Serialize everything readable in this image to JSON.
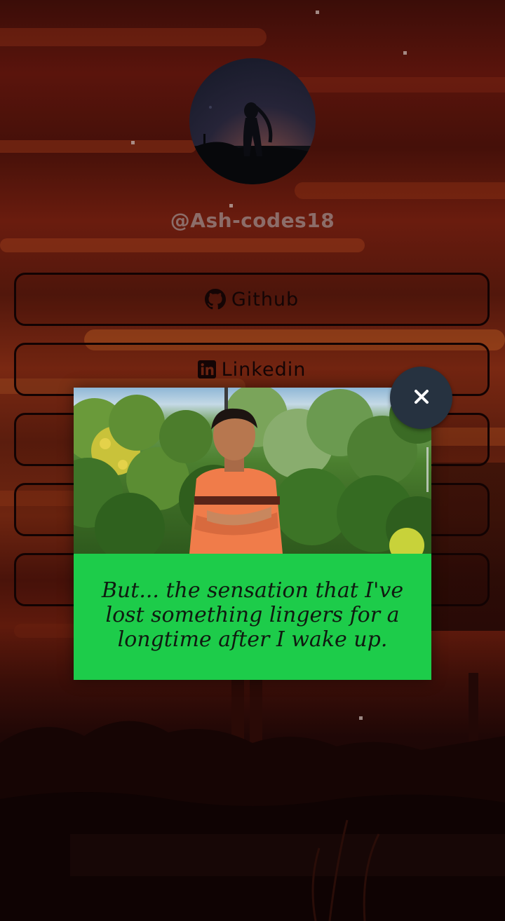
{
  "profile": {
    "handle": "@Ash-codes18"
  },
  "links": [
    {
      "label": "Github",
      "icon": "github-icon"
    },
    {
      "label": "Linkedin",
      "icon": "linkedin-icon"
    },
    {
      "label": "",
      "icon": ""
    },
    {
      "label": "",
      "icon": ""
    },
    {
      "label": "",
      "icon": ""
    }
  ],
  "modal": {
    "quote": "But... the sensation that I've lost something lingers for a longtime after I wake up.",
    "close_icon": "close-icon"
  },
  "colors": {
    "modal_background": "#1dcc4a",
    "close_button": "#263240",
    "button_border": "#120303"
  }
}
